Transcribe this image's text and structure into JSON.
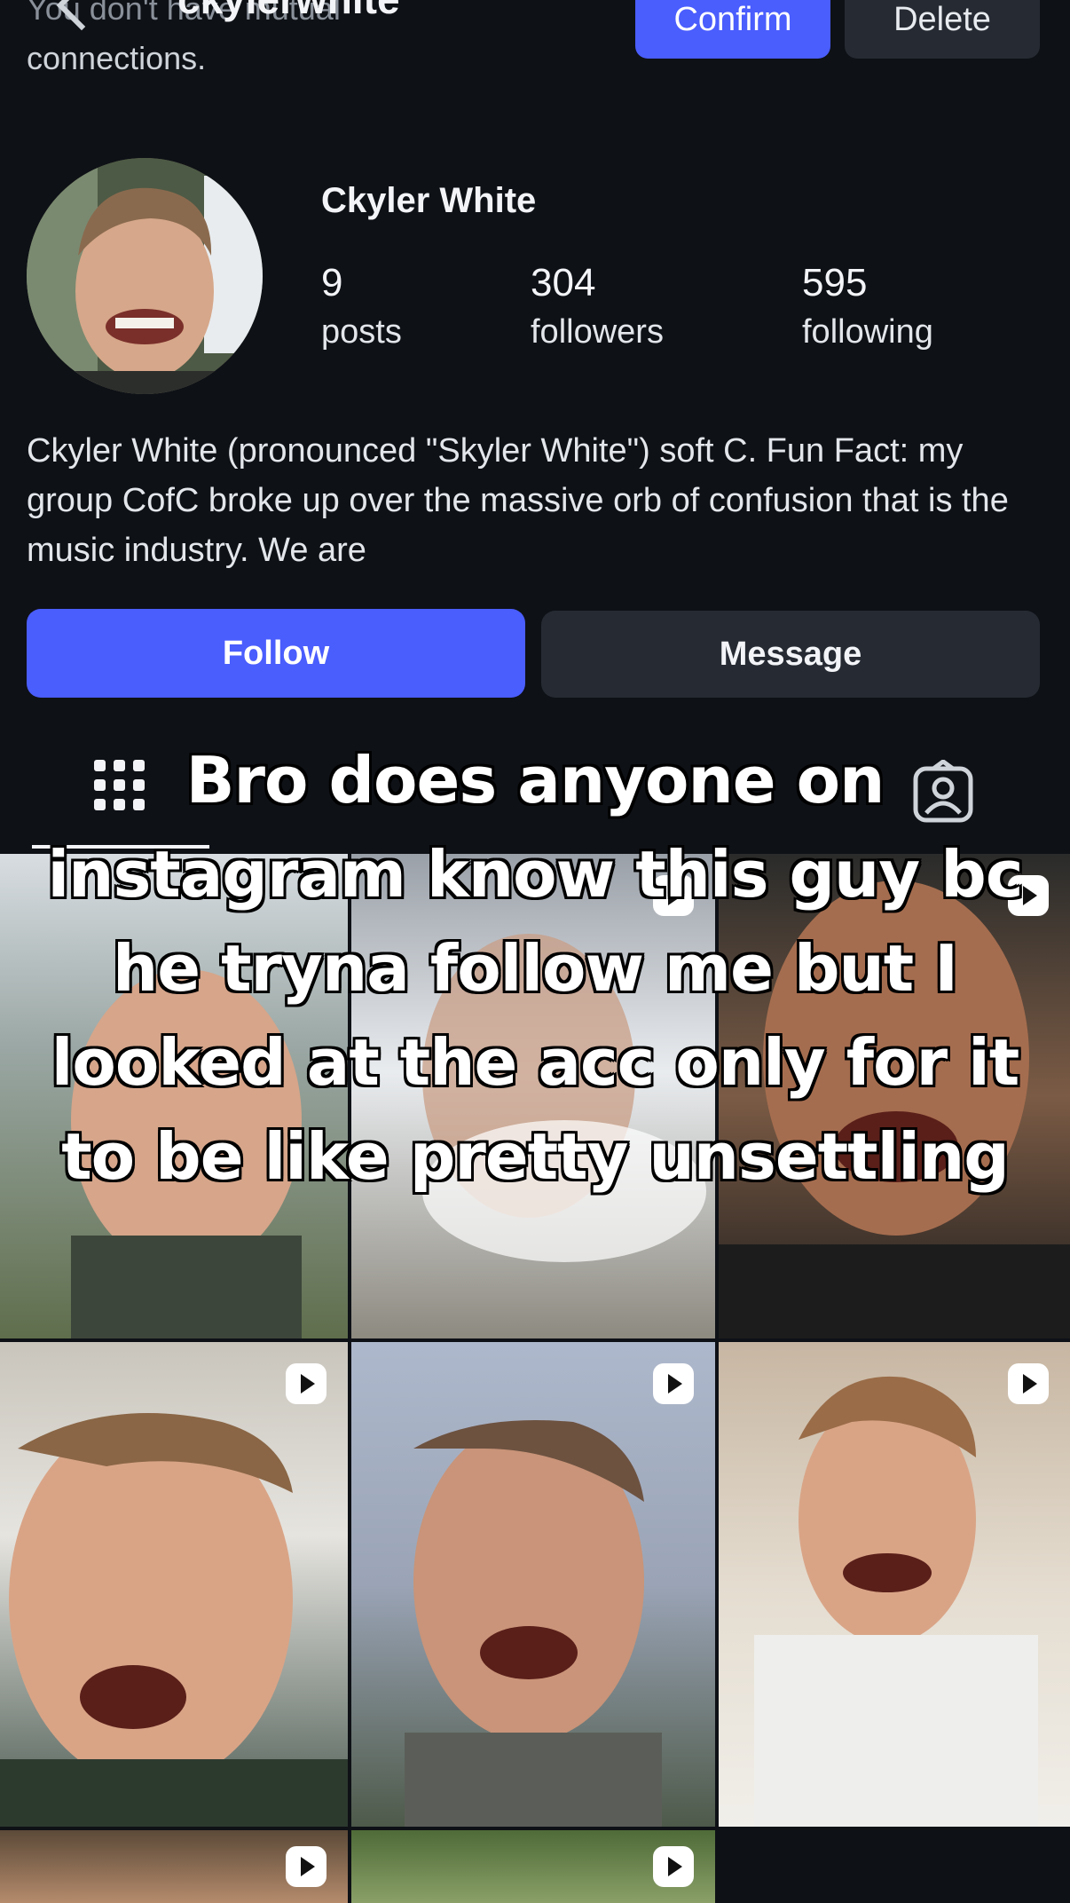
{
  "header": {
    "username": "ckylerwhite",
    "mutual_text_faded": "You don't have mutual",
    "mutual_text": "connections.",
    "confirm_label": "Confirm",
    "delete_label": "Delete"
  },
  "profile": {
    "display_name": "Ckyler White",
    "stats": {
      "posts_count": "9",
      "posts_label": "posts",
      "followers_count": "304",
      "followers_label": "followers",
      "following_count": "595",
      "following_label": "following"
    },
    "bio": "Ckyler White (pronounced \"Skyler White\") soft C. Fun Fact: my group CofC broke up over the massive orb of confusion that is the music industry. We are",
    "follow_label": "Follow",
    "message_label": "Message"
  },
  "tabs": {
    "grid_icon": "grid-icon",
    "tagged_icon": "tagged-person-icon"
  },
  "caption": "Bro does anyone on instagram know this guy bc he tryna follow me but I looked at the acc only for it to be like pretty unsettling",
  "grid": {
    "tiles": [
      {
        "reel": false
      },
      {
        "reel": true
      },
      {
        "reel": true
      },
      {
        "reel": true
      },
      {
        "reel": true
      },
      {
        "reel": true
      },
      {
        "reel": true
      },
      {
        "reel": true
      },
      {
        "reel": false
      }
    ]
  },
  "colors": {
    "background": "#0e1116",
    "primary_button": "#4a5dfd",
    "secondary_button": "#262b33",
    "text": "#f2f4f7"
  }
}
